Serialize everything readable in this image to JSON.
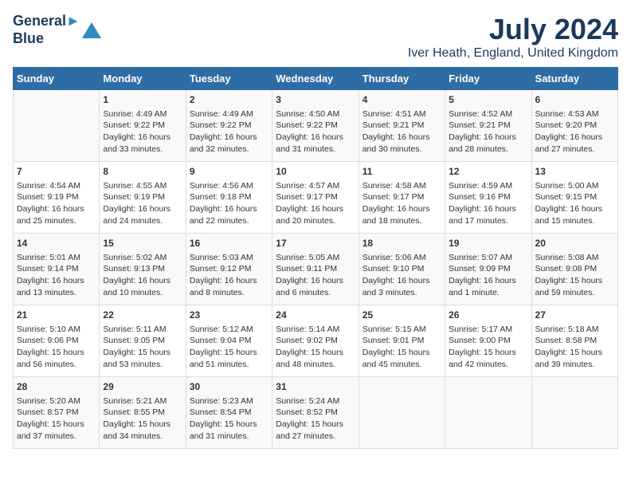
{
  "logo": {
    "line1": "General",
    "line2": "Blue"
  },
  "title": "July 2024",
  "subtitle": "Iver Heath, England, United Kingdom",
  "days_of_week": [
    "Sunday",
    "Monday",
    "Tuesday",
    "Wednesday",
    "Thursday",
    "Friday",
    "Saturday"
  ],
  "weeks": [
    [
      {
        "day": "",
        "info": ""
      },
      {
        "day": "1",
        "info": "Sunrise: 4:49 AM\nSunset: 9:22 PM\nDaylight: 16 hours\nand 33 minutes."
      },
      {
        "day": "2",
        "info": "Sunrise: 4:49 AM\nSunset: 9:22 PM\nDaylight: 16 hours\nand 32 minutes."
      },
      {
        "day": "3",
        "info": "Sunrise: 4:50 AM\nSunset: 9:22 PM\nDaylight: 16 hours\nand 31 minutes."
      },
      {
        "day": "4",
        "info": "Sunrise: 4:51 AM\nSunset: 9:21 PM\nDaylight: 16 hours\nand 30 minutes."
      },
      {
        "day": "5",
        "info": "Sunrise: 4:52 AM\nSunset: 9:21 PM\nDaylight: 16 hours\nand 28 minutes."
      },
      {
        "day": "6",
        "info": "Sunrise: 4:53 AM\nSunset: 9:20 PM\nDaylight: 16 hours\nand 27 minutes."
      }
    ],
    [
      {
        "day": "7",
        "info": "Sunrise: 4:54 AM\nSunset: 9:19 PM\nDaylight: 16 hours\nand 25 minutes."
      },
      {
        "day": "8",
        "info": "Sunrise: 4:55 AM\nSunset: 9:19 PM\nDaylight: 16 hours\nand 24 minutes."
      },
      {
        "day": "9",
        "info": "Sunrise: 4:56 AM\nSunset: 9:18 PM\nDaylight: 16 hours\nand 22 minutes."
      },
      {
        "day": "10",
        "info": "Sunrise: 4:57 AM\nSunset: 9:17 PM\nDaylight: 16 hours\nand 20 minutes."
      },
      {
        "day": "11",
        "info": "Sunrise: 4:58 AM\nSunset: 9:17 PM\nDaylight: 16 hours\nand 18 minutes."
      },
      {
        "day": "12",
        "info": "Sunrise: 4:59 AM\nSunset: 9:16 PM\nDaylight: 16 hours\nand 17 minutes."
      },
      {
        "day": "13",
        "info": "Sunrise: 5:00 AM\nSunset: 9:15 PM\nDaylight: 16 hours\nand 15 minutes."
      }
    ],
    [
      {
        "day": "14",
        "info": "Sunrise: 5:01 AM\nSunset: 9:14 PM\nDaylight: 16 hours\nand 13 minutes."
      },
      {
        "day": "15",
        "info": "Sunrise: 5:02 AM\nSunset: 9:13 PM\nDaylight: 16 hours\nand 10 minutes."
      },
      {
        "day": "16",
        "info": "Sunrise: 5:03 AM\nSunset: 9:12 PM\nDaylight: 16 hours\nand 8 minutes."
      },
      {
        "day": "17",
        "info": "Sunrise: 5:05 AM\nSunset: 9:11 PM\nDaylight: 16 hours\nand 6 minutes."
      },
      {
        "day": "18",
        "info": "Sunrise: 5:06 AM\nSunset: 9:10 PM\nDaylight: 16 hours\nand 3 minutes."
      },
      {
        "day": "19",
        "info": "Sunrise: 5:07 AM\nSunset: 9:09 PM\nDaylight: 16 hours\nand 1 minute."
      },
      {
        "day": "20",
        "info": "Sunrise: 5:08 AM\nSunset: 9:08 PM\nDaylight: 15 hours\nand 59 minutes."
      }
    ],
    [
      {
        "day": "21",
        "info": "Sunrise: 5:10 AM\nSunset: 9:06 PM\nDaylight: 15 hours\nand 56 minutes."
      },
      {
        "day": "22",
        "info": "Sunrise: 5:11 AM\nSunset: 9:05 PM\nDaylight: 15 hours\nand 53 minutes."
      },
      {
        "day": "23",
        "info": "Sunrise: 5:12 AM\nSunset: 9:04 PM\nDaylight: 15 hours\nand 51 minutes."
      },
      {
        "day": "24",
        "info": "Sunrise: 5:14 AM\nSunset: 9:02 PM\nDaylight: 15 hours\nand 48 minutes."
      },
      {
        "day": "25",
        "info": "Sunrise: 5:15 AM\nSunset: 9:01 PM\nDaylight: 15 hours\nand 45 minutes."
      },
      {
        "day": "26",
        "info": "Sunrise: 5:17 AM\nSunset: 9:00 PM\nDaylight: 15 hours\nand 42 minutes."
      },
      {
        "day": "27",
        "info": "Sunrise: 5:18 AM\nSunset: 8:58 PM\nDaylight: 15 hours\nand 39 minutes."
      }
    ],
    [
      {
        "day": "28",
        "info": "Sunrise: 5:20 AM\nSunset: 8:57 PM\nDaylight: 15 hours\nand 37 minutes."
      },
      {
        "day": "29",
        "info": "Sunrise: 5:21 AM\nSunset: 8:55 PM\nDaylight: 15 hours\nand 34 minutes."
      },
      {
        "day": "30",
        "info": "Sunrise: 5:23 AM\nSunset: 8:54 PM\nDaylight: 15 hours\nand 31 minutes."
      },
      {
        "day": "31",
        "info": "Sunrise: 5:24 AM\nSunset: 8:52 PM\nDaylight: 15 hours\nand 27 minutes."
      },
      {
        "day": "",
        "info": ""
      },
      {
        "day": "",
        "info": ""
      },
      {
        "day": "",
        "info": ""
      }
    ]
  ]
}
